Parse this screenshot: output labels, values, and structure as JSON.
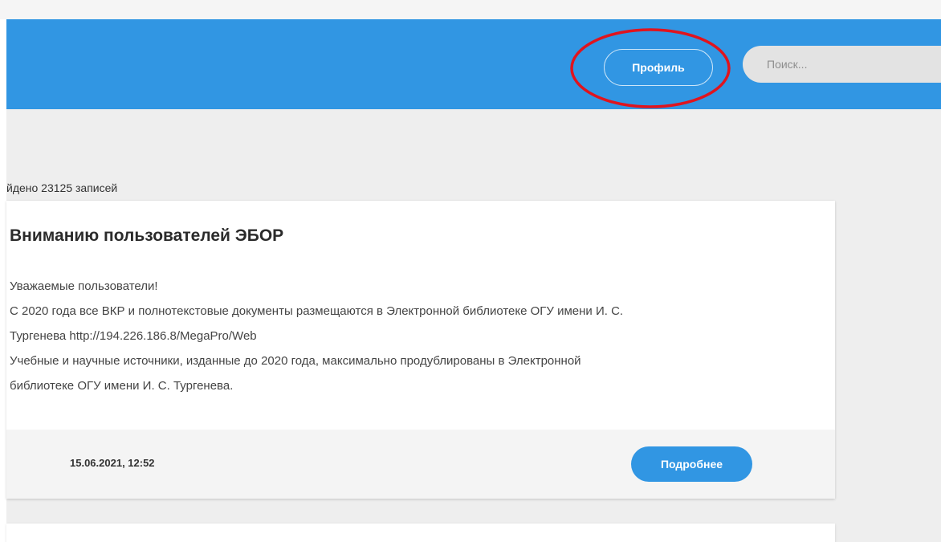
{
  "header": {
    "profile_label": "Профиль",
    "search_placeholder": "Поиск..."
  },
  "results": {
    "count_text": "йдено 23125 записей"
  },
  "card": {
    "title": "Вниманию пользователей ЭБОР",
    "body_lines": [
      "Уважаемые пользователи!",
      "С 2020 года все ВКР и полнотекстовые документы размещаются в Электронной библиотеке ОГУ имени И. С.",
      "Тургенева http://194.226.186.8/MegaPro/Web",
      "Учебные и научные источники, изданные до 2020 года,  максимально продублированы в Электронной",
      "библиотеке ОГУ имени И. С. Тургенева."
    ],
    "date": "15.06.2021, 12:52",
    "more_label": "Подробнее"
  },
  "colors": {
    "brand_blue": "#3196e3",
    "annotation_red": "#e0141e",
    "page_bg": "#eeeeee"
  }
}
